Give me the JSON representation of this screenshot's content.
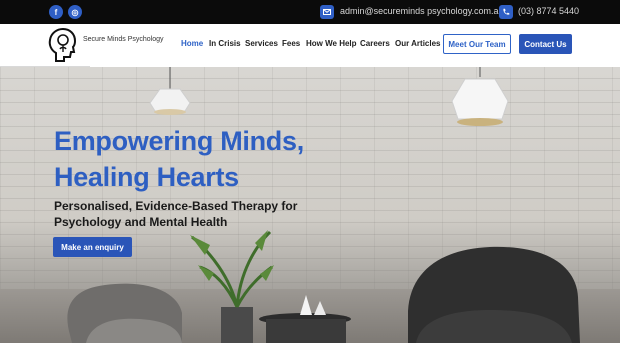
{
  "topbar": {
    "social": [
      {
        "icon": "facebook-icon",
        "glyph": "f"
      },
      {
        "icon": "instagram-icon",
        "glyph": "◎"
      }
    ],
    "email": {
      "icon": "mail-icon",
      "text": "admin@secureminds psychology.com.au"
    },
    "phone": {
      "icon": "phone-icon",
      "text": "(03) 8774 5440"
    }
  },
  "header": {
    "brand": "Secure Minds Psychology",
    "nav": [
      "Home",
      "In Crisis",
      "Services",
      "Fees",
      "How We Help",
      "Careers",
      "Our Articles"
    ],
    "active_nav": "Home",
    "meet_team": "Meet Our Team",
    "contact_us": "Contact Us"
  },
  "hero": {
    "headline_1": "Empowering Minds,",
    "headline_2": "Healing Hearts",
    "subtitle_1": "Personalised, Evidence-Based Therapy for",
    "subtitle_2": "Psychology and Mental Health",
    "cta": "Make an enquiry"
  },
  "colors": {
    "accent": "#2e5fc2",
    "button": "#2a55b8",
    "topbar": "#0b0b0b"
  }
}
